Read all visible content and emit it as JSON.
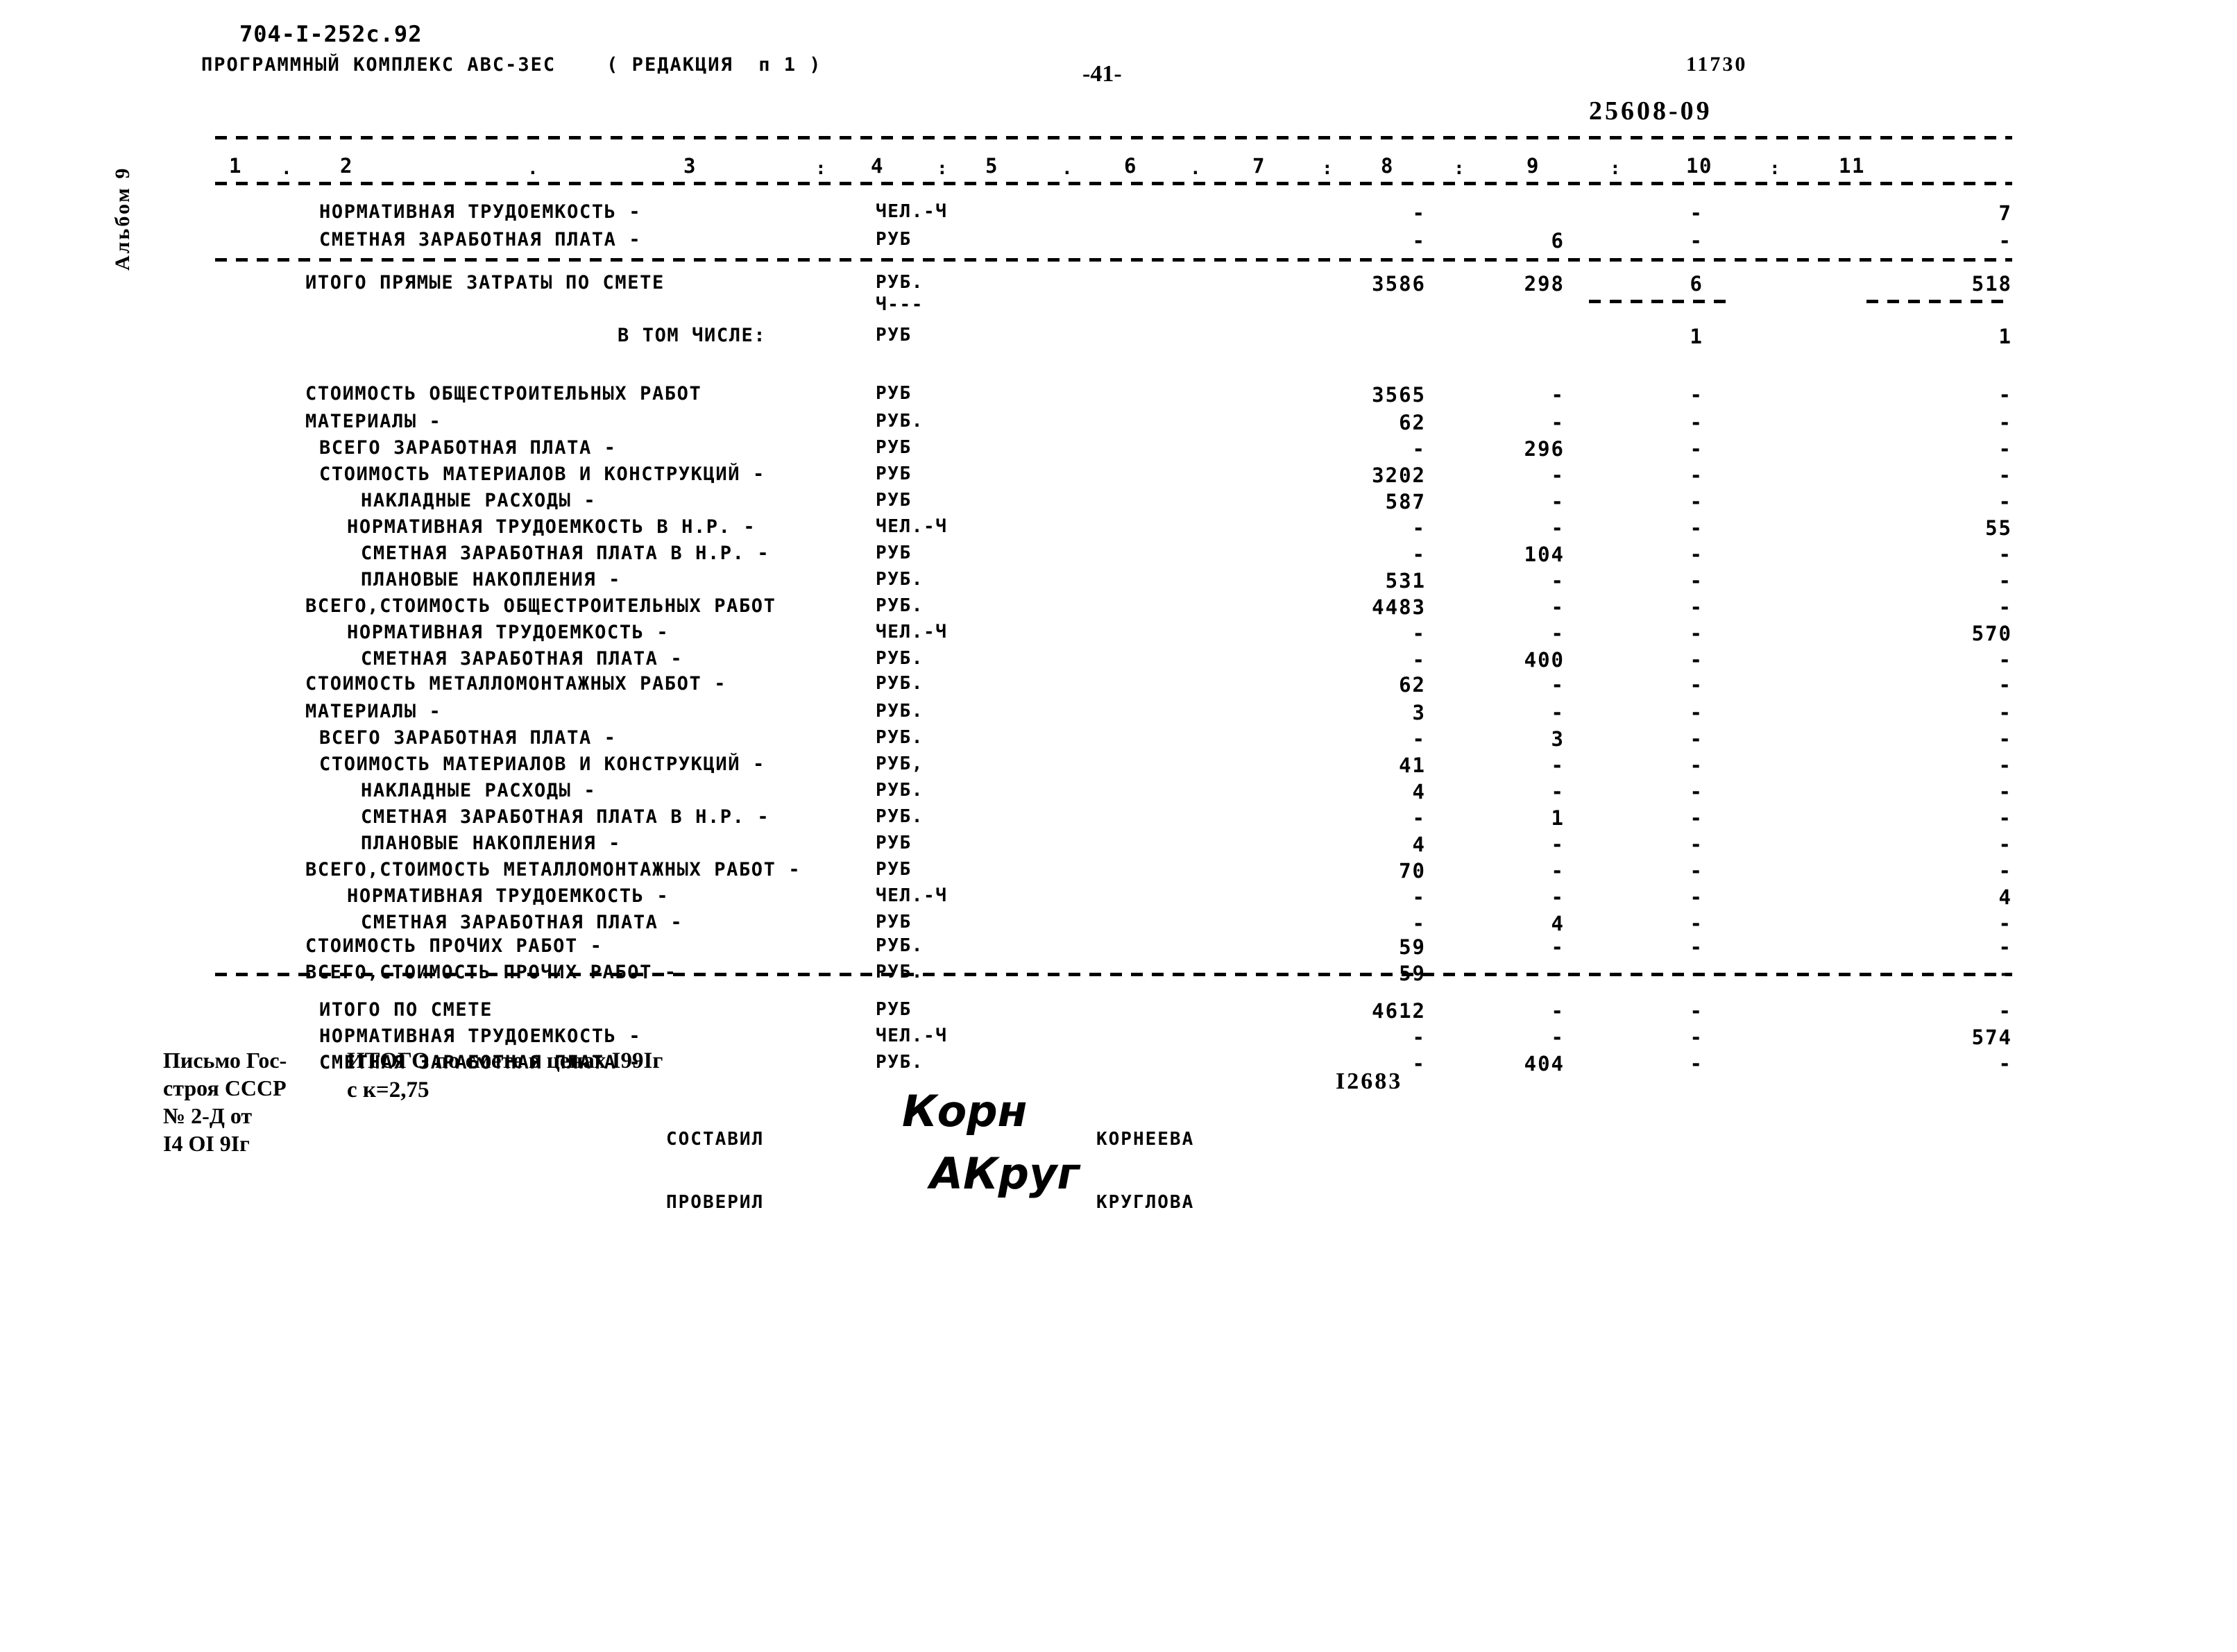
{
  "header": {
    "doc_code": "704-I-252c.92",
    "program_line": "ПРОГРАММНЫЙ КОМПЛЕКС АВС-3ЕС    ( РЕДАКЦИЯ  п 1 )",
    "page_number": "-41-",
    "sheet_number": "11730",
    "doc_number": "25608-09",
    "album_label": "Альбом 9"
  },
  "table": {
    "column_numbers": [
      "1",
      "2",
      "3",
      "4",
      "5",
      "6",
      "7",
      "8",
      "9",
      "10",
      "11"
    ],
    "column_separators": [
      ".",
      ".",
      ":",
      ":",
      ".",
      ".",
      ":",
      ":",
      ":",
      ":"
    ],
    "rows": [
      {
        "label": "НОРМАТИВНАЯ ТРУДОЕМКОСТЬ -",
        "indent": 1,
        "unit": "ЧЕЛ.-Ч",
        "c7": "-",
        "c8": "",
        "c9": "-",
        "c11": "7"
      },
      {
        "label": "СМЕТНАЯ ЗАРАБОТНАЯ ПЛАТА -",
        "indent": 1,
        "unit": "РУБ",
        "c7": "-",
        "c8": "6",
        "c9": "-",
        "c11": "-"
      },
      {
        "label": "ИТОГО ПРЯМЫЕ ЗАТРАТЫ ПО СМЕТЕ",
        "indent": 0,
        "unit": "РУБ.",
        "c7": "3586",
        "c8": "298",
        "c9": "6",
        "c11": "518"
      },
      {
        "label": "",
        "indent": 0,
        "unit": "Ч---",
        "c7": "",
        "c8": "",
        "c9": "",
        "c11": ""
      },
      {
        "label": "В ТОМ ЧИСЛЕ:",
        "indent": 4,
        "unit": "РУБ",
        "c7": "",
        "c8": "",
        "c9": "1",
        "c11": "1"
      },
      {
        "label": "СТОИМОСТЬ ОБЩЕСТРОИТЕЛЬНЫХ РАБОТ",
        "indent": 0,
        "unit": "РУБ",
        "c7": "3565",
        "c8": "-",
        "c9": "-",
        "c11": "-"
      },
      {
        "label": "МАТЕРИАЛЫ -",
        "indent": 0,
        "unit": "РУБ.",
        "c7": "62",
        "c8": "-",
        "c9": "-",
        "c11": "-"
      },
      {
        "label": "ВСЕГО ЗАРАБОТНАЯ ПЛАТА -",
        "indent": 1,
        "unit": "РУБ",
        "c7": "-",
        "c8": "296",
        "c9": "-",
        "c11": "-"
      },
      {
        "label": "СТОИМОСТЬ МАТЕРИАЛОВ И КОНСТРУКЦИЙ -",
        "indent": 1,
        "unit": "РУБ",
        "c7": "3202",
        "c8": "-",
        "c9": "-",
        "c11": "-"
      },
      {
        "label": "НАКЛАДНЫЕ РАСХОДЫ -",
        "indent": 3,
        "unit": "РУБ",
        "c7": "587",
        "c8": "-",
        "c9": "-",
        "c11": "-"
      },
      {
        "label": "НОРМАТИВНАЯ ТРУДОЕМКОСТЬ В Н.Р. -",
        "indent": 2,
        "unit": "ЧЕЛ.-Ч",
        "c7": "-",
        "c8": "-",
        "c9": "-",
        "c11": "55"
      },
      {
        "label": "СМЕТНАЯ ЗАРАБОТНАЯ ПЛАТА В Н.Р. -",
        "indent": 3,
        "unit": "РУБ",
        "c7": "-",
        "c8": "104",
        "c9": "-",
        "c11": "-"
      },
      {
        "label": "ПЛАНОВЫЕ НАКОПЛЕНИЯ -",
        "indent": 3,
        "unit": "РУБ.",
        "c7": "531",
        "c8": "-",
        "c9": "-",
        "c11": "-"
      },
      {
        "label": "ВСЕГО,СТОИМОСТЬ ОБЩЕСТРОИТЕЛЬНЫХ РАБОТ",
        "indent": 0,
        "unit": "РУБ.",
        "c7": "4483",
        "c8": "-",
        "c9": "-",
        "c11": "-"
      },
      {
        "label": "НОРМАТИВНАЯ ТРУДОЕМКОСТЬ -",
        "indent": 2,
        "unit": "ЧЕЛ.-Ч",
        "c7": "-",
        "c8": "-",
        "c9": "-",
        "c11": "570"
      },
      {
        "label": "СМЕТНАЯ ЗАРАБОТНАЯ ПЛАТА -",
        "indent": 3,
        "unit": "РУБ.",
        "c7": "-",
        "c8": "400",
        "c9": "-",
        "c11": "-"
      },
      {
        "label": "СТОИМОСТЬ МЕТАЛЛОМОНТАЖНЫХ РАБОТ -",
        "indent": 0,
        "unit": "РУБ.",
        "c7": "62",
        "c8": "-",
        "c9": "-",
        "c11": "-"
      },
      {
        "label": "МАТЕРИАЛЫ -",
        "indent": 0,
        "unit": "РУБ.",
        "c7": "3",
        "c8": "-",
        "c9": "-",
        "c11": "-"
      },
      {
        "label": "ВСЕГО ЗАРАБОТНАЯ ПЛАТА -",
        "indent": 1,
        "unit": "РУБ.",
        "c7": "-",
        "c8": "3",
        "c9": "-",
        "c11": "-"
      },
      {
        "label": "СТОИМОСТЬ МАТЕРИАЛОВ И КОНСТРУКЦИЙ -",
        "indent": 1,
        "unit": "РУБ,",
        "c7": "41",
        "c8": "-",
        "c9": "-",
        "c11": "-"
      },
      {
        "label": "НАКЛАДНЫЕ РАСХОДЫ -",
        "indent": 3,
        "unit": "РУБ.",
        "c7": "4",
        "c8": "-",
        "c9": "-",
        "c11": "-"
      },
      {
        "label": "СМЕТНАЯ ЗАРАБОТНАЯ ПЛАТА  В Н.Р. -",
        "indent": 3,
        "unit": "РУБ.",
        "c7": "-",
        "c8": "1",
        "c9": "-",
        "c11": "-"
      },
      {
        "label": "ПЛАНОВЫЕ НАКОПЛЕНИЯ -",
        "indent": 3,
        "unit": "РУБ",
        "c7": "4",
        "c8": "-",
        "c9": "-",
        "c11": "-"
      },
      {
        "label": "ВСЕГО,СТОИМОСТЬ МЕТАЛЛОМОНТАЖНЫХ РАБОТ -",
        "indent": 0,
        "unit": "РУБ",
        "c7": "70",
        "c8": "-",
        "c9": "-",
        "c11": "-"
      },
      {
        "label": "НОРМАТИВНАЯ ТРУДОЕМКОСТЬ -",
        "indent": 2,
        "unit": "ЧЕЛ.-Ч",
        "c7": "-",
        "c8": "-",
        "c9": "-",
        "c11": "4"
      },
      {
        "label": "СМЕТНАЯ ЗАРАБОТНАЯ ПЛАТА -",
        "indent": 3,
        "unit": "РУБ",
        "c7": "-",
        "c8": "4",
        "c9": "-",
        "c11": "-"
      },
      {
        "label": "СТОИМОСТЬ ПРОЧИХ РАБОТ -",
        "indent": 0,
        "unit": "РУБ.",
        "c7": "59",
        "c8": "-",
        "c9": "-",
        "c11": "-"
      },
      {
        "label": "ВСЕГО,СТОИМОСТЬ ПРОЧИХ РАБОТ -",
        "indent": 0,
        "unit": "РУБ.",
        "c7": "59",
        "c8": "-",
        "c9": "-",
        "c11": "-"
      },
      {
        "label": "ИТОГО ПО СМЕТЕ",
        "indent": 1,
        "unit": "РУБ",
        "c7": "4612",
        "c8": "-",
        "c9": "-",
        "c11": "-"
      },
      {
        "label": "НОРМАТИВНАЯ ТРУДОЕМКОСТЬ -",
        "indent": 1,
        "unit": "ЧЕЛ.-Ч",
        "c7": "-",
        "c8": "-",
        "c9": "-",
        "c11": "574"
      },
      {
        "label": "СМЕТНАЯ ЗАРАБОТНАЯ ПЛАТА -",
        "indent": 1,
        "unit": "РУБ.",
        "c7": "-",
        "c8": "404",
        "c9": "-",
        "c11": "-"
      }
    ]
  },
  "footer": {
    "gosstroy_note": "Письмо Гос-\nстроя СССР\n№ 2-Д от\nI4 OI 9Iг",
    "final_line_1": "ИТОГО по смете в ценах I99Iг",
    "final_line_2": "с к=2,75",
    "total_1991": "I2683",
    "compiled_by_role": "СОСТАВИЛ",
    "compiled_by_name": "КОРНЕЕВА",
    "compiled_by_signature": "Корн",
    "checked_by_role": "ПРОВЕРИЛ",
    "checked_by_name": "КРУГЛОВА",
    "checked_by_signature": "АКруг"
  }
}
